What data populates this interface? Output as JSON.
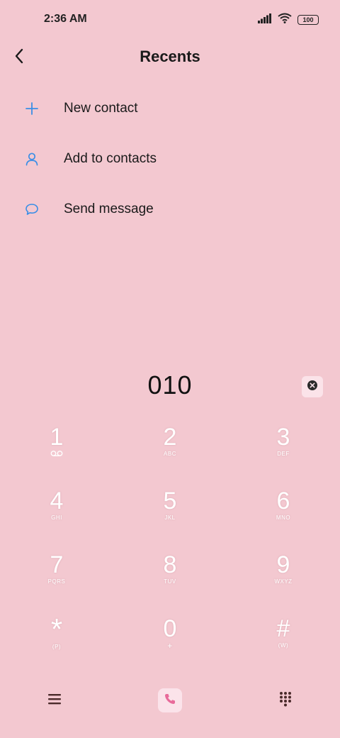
{
  "status_bar": {
    "time": "2:36 AM",
    "battery": "100",
    "icons": [
      "signal-icon",
      "wifi-icon",
      "battery-icon"
    ]
  },
  "header": {
    "title": "Recents",
    "back_icon": "chevron-left-icon"
  },
  "actions": [
    {
      "label": "New contact",
      "icon": "plus-icon"
    },
    {
      "label": "Add to contacts",
      "icon": "person-icon"
    },
    {
      "label": "Send message",
      "icon": "chat-bubble-icon"
    }
  ],
  "dialer": {
    "number": "010",
    "delete_icon": "backspace-icon"
  },
  "keypad": [
    {
      "digit": "1",
      "sub": "",
      "sub_icon": "voicemail-icon"
    },
    {
      "digit": "2",
      "sub": "ABC"
    },
    {
      "digit": "3",
      "sub": "DEF"
    },
    {
      "digit": "4",
      "sub": "GHI"
    },
    {
      "digit": "5",
      "sub": "JKL"
    },
    {
      "digit": "6",
      "sub": "MNO"
    },
    {
      "digit": "7",
      "sub": "PQRS"
    },
    {
      "digit": "8",
      "sub": "TUV"
    },
    {
      "digit": "9",
      "sub": "WXYZ"
    },
    {
      "digit": "*",
      "sub": "(P)"
    },
    {
      "digit": "0",
      "sub": "+"
    },
    {
      "digit": "#",
      "sub": "(W)"
    }
  ],
  "bottom_bar": {
    "menu_icon": "hamburger-menu-icon",
    "call_icon": "phone-icon",
    "dialpad_icon": "dialpad-icon"
  },
  "colors": {
    "background": "#f3c8d0",
    "accent_blue": "#3a8ee6",
    "call_pink": "#e86a9a"
  }
}
